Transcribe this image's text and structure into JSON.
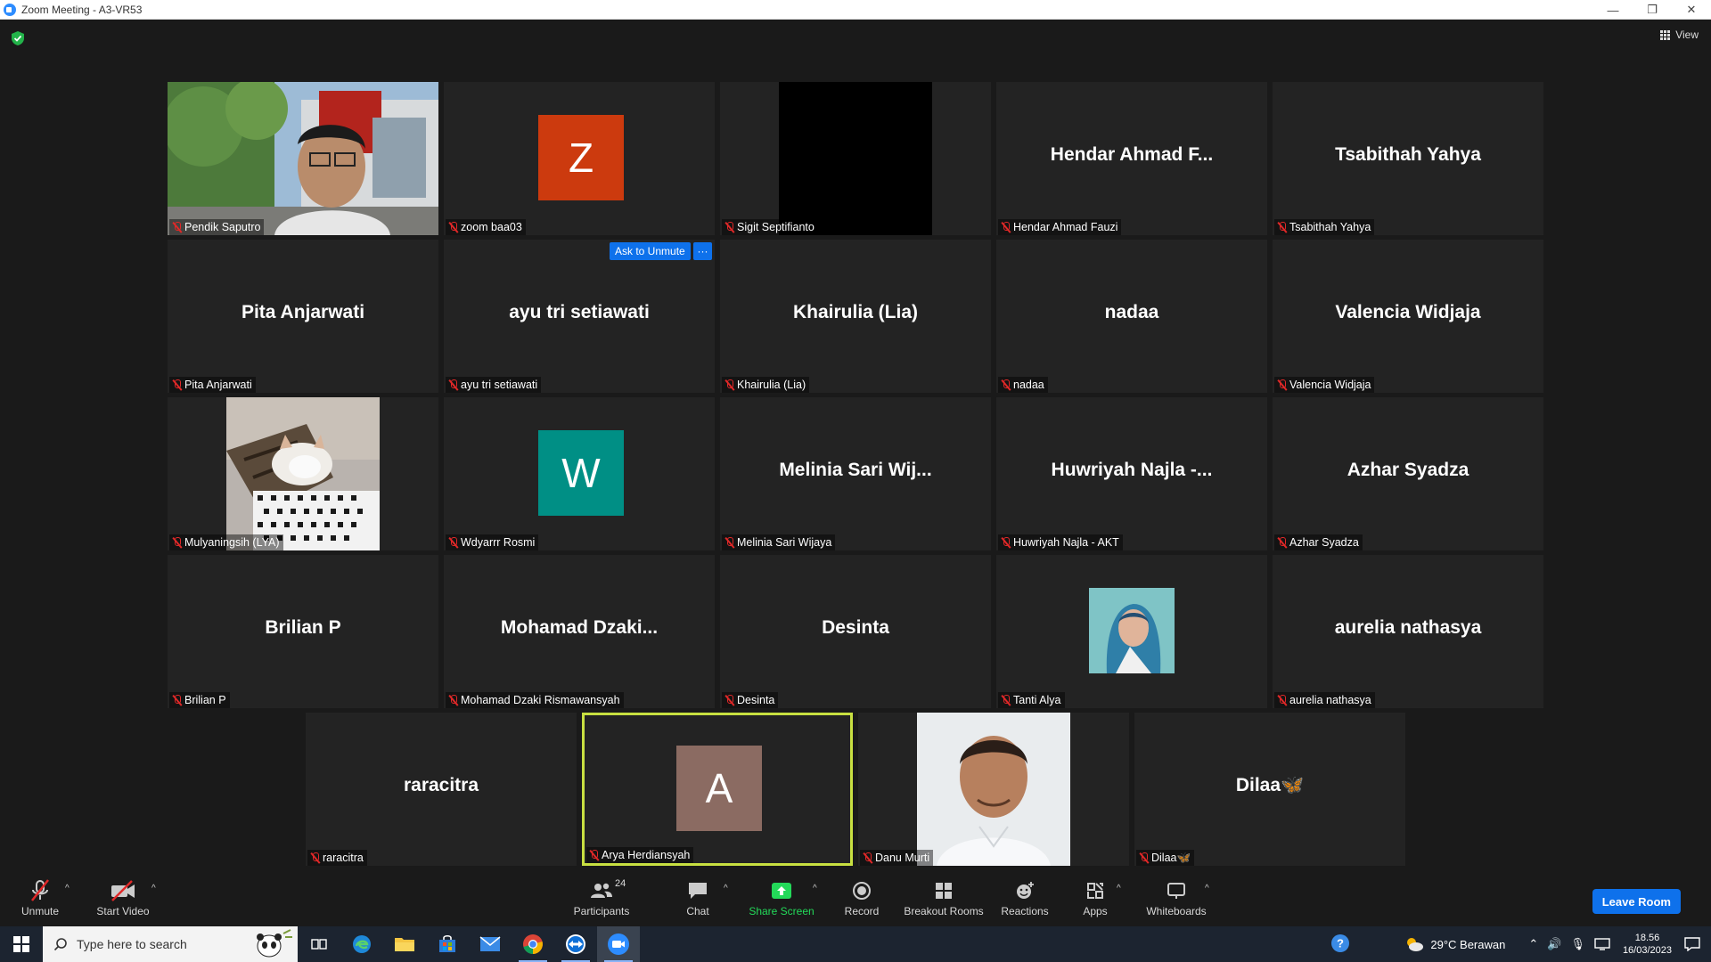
{
  "window": {
    "title": "Zoom Meeting - A3-VR53",
    "minimize": "—",
    "restore": "❐",
    "close": "✕"
  },
  "view_label": "View",
  "ask_to_unmute": "Ask to Unmute",
  "more_label": "···",
  "tiles": [
    {
      "big": "",
      "label": "Pendik Saputro",
      "type": "photo-man-building"
    },
    {
      "big": "",
      "label": "zoom baa03",
      "type": "avatar",
      "letter": "Z",
      "color": "#cc3a0e"
    },
    {
      "big": "",
      "label": "Sigit Septifianto",
      "type": "black"
    },
    {
      "big": "Hendar Ahmad F...",
      "label": "Hendar Ahmad Fauzi"
    },
    {
      "big": "Tsabithah Yahya",
      "label": "Tsabithah Yahya"
    },
    {
      "big": "Pita Anjarwati",
      "label": "Pita Anjarwati"
    },
    {
      "big": "ayu tri setiawati",
      "label": "ayu tri setiawati"
    },
    {
      "big": "Khairulia (Lia)",
      "label": "Khairulia (Lia)"
    },
    {
      "big": "nadaa",
      "label": "nadaa"
    },
    {
      "big": "Valencia Widjaja",
      "label": "Valencia Widjaja"
    },
    {
      "big": "",
      "label": "Mulyaningsih (LYA)",
      "type": "photo-cat"
    },
    {
      "big": "",
      "label": "Wdyarrr Rosmi",
      "type": "avatar",
      "letter": "W",
      "color": "#008f85"
    },
    {
      "big": "Melinia Sari Wij...",
      "label": "Melinia Sari Wijaya"
    },
    {
      "big": "Huwriyah Najla -...",
      "label": "Huwriyah Najla - AKT"
    },
    {
      "big": "Azhar Syadza",
      "label": "Azhar Syadza"
    },
    {
      "big": "Brilian P",
      "label": "Brilian P"
    },
    {
      "big": "Mohamad  Dzaki...",
      "label": "Mohamad Dzaki Rismawansyah"
    },
    {
      "big": "Desinta",
      "label": "Desinta"
    },
    {
      "big": "",
      "label": "Tanti Alya",
      "type": "photo-hijab"
    },
    {
      "big": "aurelia nathasya",
      "label": "aurelia nathasya"
    },
    {
      "big": "raracitra",
      "label": "raracitra"
    },
    {
      "big": "",
      "label": "Arya Herdiansyah",
      "type": "avatar",
      "letter": "A",
      "color": "#8b6b62",
      "active": true
    },
    {
      "big": "",
      "label": "Danu Murti",
      "type": "photo-man-white"
    },
    {
      "big": "Dilaa🦋",
      "label": "Dilaa🦋"
    }
  ],
  "toolbar": {
    "unmute": "Unmute",
    "start_video": "Start Video",
    "participants": "Participants",
    "participants_count": "24",
    "chat": "Chat",
    "share_screen": "Share Screen",
    "record": "Record",
    "breakout_rooms": "Breakout Rooms",
    "reactions": "Reactions",
    "apps": "Apps",
    "whiteboards": "Whiteboards",
    "leave_room": "Leave Room"
  },
  "taskbar": {
    "search_placeholder": "Type here to search",
    "weather": "29°C  Berawan",
    "time": "18.56",
    "date": "16/03/2023"
  },
  "colors": {
    "accent": "#0e71eb",
    "share_green": "#23d959",
    "muted_red": "#e02828",
    "active_border": "#c8e041"
  }
}
